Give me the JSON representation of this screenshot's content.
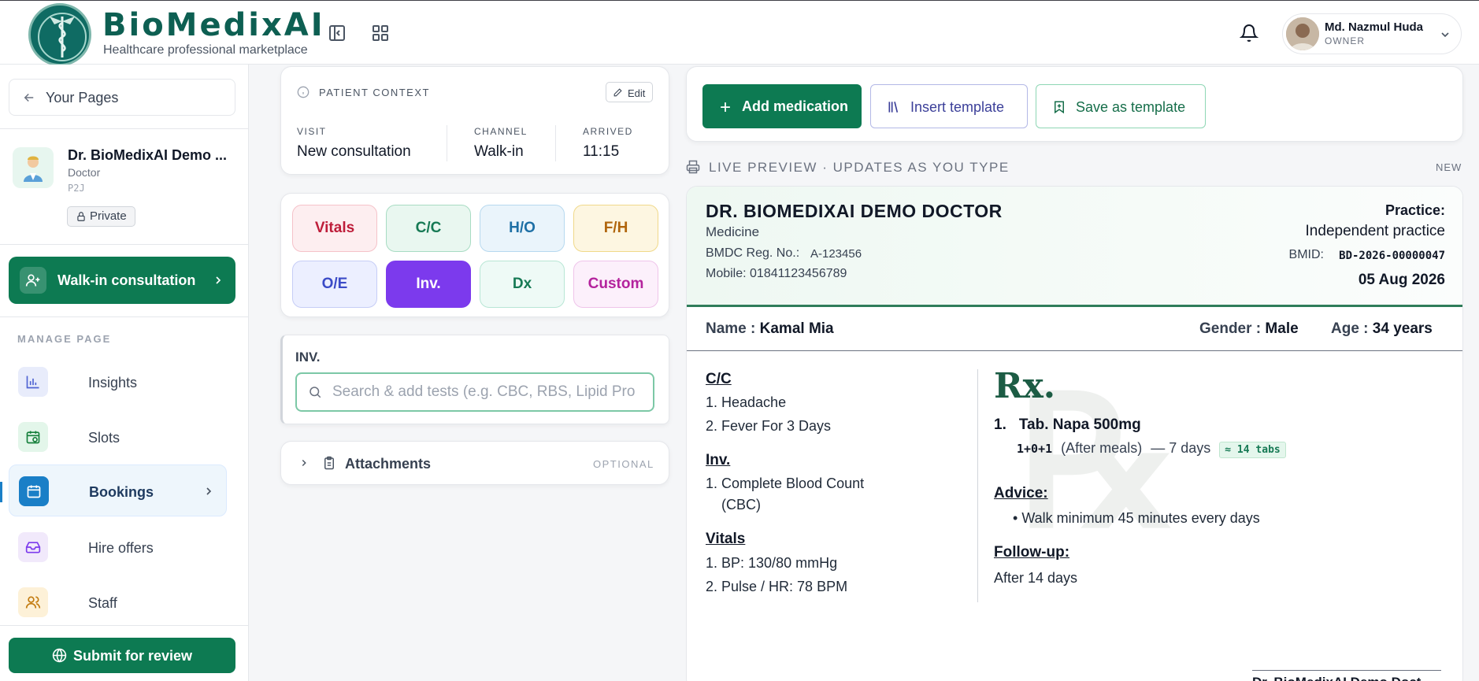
{
  "app": {
    "brand": "BioMedixAI",
    "tagline": "Healthcare professional marketplace"
  },
  "user": {
    "name": "Md. Nazmul Huda",
    "role": "OWNER"
  },
  "sidebar": {
    "back_label": "Your Pages",
    "doctor": {
      "name": "Dr. BioMedixAI Demo ...",
      "title": "Doctor",
      "code": "P2J",
      "visibility": "Private"
    },
    "walkin_label": "Walk-in consultation",
    "section_label": "MANAGE PAGE",
    "items": [
      {
        "label": "Insights",
        "icon": "chart-icon"
      },
      {
        "label": "Slots",
        "icon": "calendar-clock-icon"
      },
      {
        "label": "Bookings",
        "icon": "calendar-icon",
        "active": true
      },
      {
        "label": "Hire offers",
        "icon": "inbox-icon"
      },
      {
        "label": "Staff",
        "icon": "users-icon"
      }
    ],
    "submit_label": "Submit for review"
  },
  "patient_context": {
    "title": "PATIENT CONTEXT",
    "edit_label": "Edit",
    "fields": [
      {
        "label": "VISIT",
        "value": "New consultation"
      },
      {
        "label": "CHANNEL",
        "value": "Walk-in"
      },
      {
        "label": "ARRIVED",
        "value": "11:15"
      }
    ]
  },
  "sections": {
    "chips": [
      "Vitals",
      "C/C",
      "H/O",
      "F/H",
      "O/E",
      "Inv.",
      "Dx",
      "Custom"
    ],
    "active": "Inv."
  },
  "inv_panel": {
    "title": "INV.",
    "search_placeholder": "Search & add tests (e.g. CBC, RBS, Lipid Pro"
  },
  "attachments": {
    "label": "Attachments",
    "tag": "OPTIONAL"
  },
  "actions": {
    "add_medication": "Add medication",
    "insert_template": "Insert template",
    "save_template": "Save as template"
  },
  "preview": {
    "label": "LIVE PREVIEW · UPDATES AS YOU TYPE",
    "badge": "NEW"
  },
  "prescription": {
    "doctor_name": "DR. BIOMEDIXAI DEMO DOCTOR",
    "specialty": "Medicine",
    "reg_label": "BMDC Reg. No.:",
    "reg_value": "A-123456",
    "mobile": "Mobile: 01841123456789",
    "practice_label": "Practice:",
    "practice_value": "Independent practice",
    "bmid_label": "BMID:",
    "bmid_value": "BD-2026-00000047",
    "date": "05 Aug 2026",
    "patient": {
      "name_label": "Name",
      "name": "Kamal Mia",
      "gender_label": "Gender",
      "gender": "Male",
      "age_label": "Age",
      "age": "34 years"
    },
    "cc_title": "C/C",
    "cc": [
      "Headache",
      "Fever For 3 Days"
    ],
    "inv_title": "Inv.",
    "inv": [
      "Complete Blood Count",
      "(CBC)"
    ],
    "vitals_title": "Vitals",
    "vitals": [
      "BP: 130/80 mmHg",
      "Pulse / HR: 78 BPM"
    ],
    "rx_symbol": "Rx.",
    "med": {
      "name": "Tab. Napa 500mg",
      "dose": "1+0+1",
      "timing": "(After meals)",
      "duration": "— 7 days",
      "qty": "≈ 14 tabs"
    },
    "advice_title": "Advice:",
    "advice": [
      "Walk minimum 45 minutes every days"
    ],
    "followup_title": "Follow-up:",
    "followup": "After 14 days",
    "signature": "Dr. BioMedixAI Demo Doct"
  }
}
